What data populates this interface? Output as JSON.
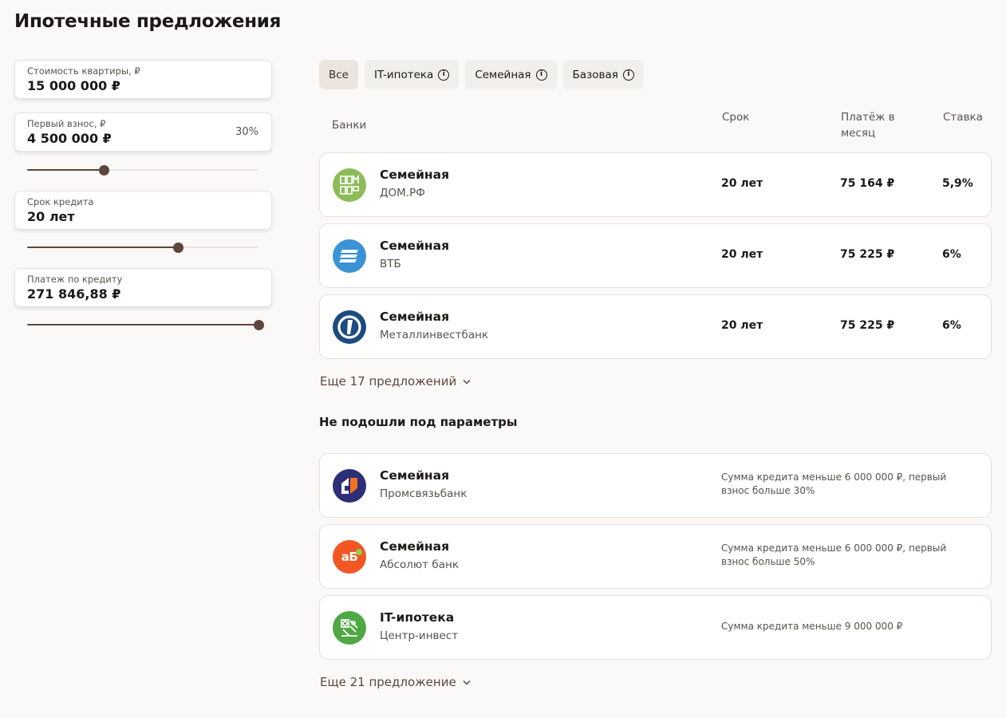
{
  "title": "Ипотечные предложения",
  "form": {
    "price": {
      "label": "Стоимость квартиры, ₽",
      "value": "15 000 000 ₽"
    },
    "down": {
      "label": "Первый взнос, ₽",
      "value": "4 500 000 ₽",
      "percent": "30%",
      "slider_fraction": 0.33
    },
    "term": {
      "label": "Срок кредита",
      "value": "20 лет",
      "slider_fraction": 0.65
    },
    "payment": {
      "label": "Платеж по кредиту",
      "value": "271 846,88 ₽",
      "slider_fraction": 1.0
    }
  },
  "filters": [
    {
      "label": "Все",
      "active": true,
      "info": false
    },
    {
      "label": "IT-ипотека",
      "active": false,
      "info": true
    },
    {
      "label": "Семейная",
      "active": false,
      "info": true
    },
    {
      "label": "Базовая",
      "active": false,
      "info": true
    }
  ],
  "headers": {
    "banks": "Банки",
    "term": "Срок",
    "payment": "Платёж в месяц",
    "rate": "Ставка"
  },
  "offers": [
    {
      "product": "Семейная",
      "bank": "ДОМ.РФ",
      "term": "20 лет",
      "payment": "75 164 ₽",
      "rate": "5,9%",
      "icon": "domrf-logo-icon",
      "color": "#8dbb5a"
    },
    {
      "product": "Семейная",
      "bank": "ВТБ",
      "term": "20 лет",
      "payment": "75 225 ₽",
      "rate": "6%",
      "icon": "vtb-logo-icon",
      "color": "#3b93d6"
    },
    {
      "product": "Семейная",
      "bank": "Металлинвестбанк",
      "term": "20 лет",
      "payment": "75 225 ₽",
      "rate": "6%",
      "icon": "metallinvestbank-logo-icon",
      "color": "#1d4a80"
    }
  ],
  "more_offers": "Еще 17 предложений",
  "unfit_title": "Не подошли под параметры",
  "unfit": [
    {
      "product": "Семейная",
      "bank": "Промсвязьбанк",
      "reason": "Сумма кредита меньше 6 000 000 ₽, первый взнос больше 30%",
      "icon": "psb-logo-icon",
      "color": "#2c2f77"
    },
    {
      "product": "Семейная",
      "bank": "Абсолют банк",
      "reason": "Сумма кредита меньше 6 000 000 ₽, первый взнос больше 50%",
      "icon": "absolut-logo-icon",
      "color": "#f25623"
    },
    {
      "product": "IT-ипотека",
      "bank": "Центр-инвест",
      "reason": "Сумма кредита меньше 9 000 000 ₽",
      "icon": "centrinvest-logo-icon",
      "color": "#4fa843"
    }
  ],
  "more_unfit": "Еще 21 предложение",
  "logo_texts": {
    "absolut": "аБ"
  }
}
